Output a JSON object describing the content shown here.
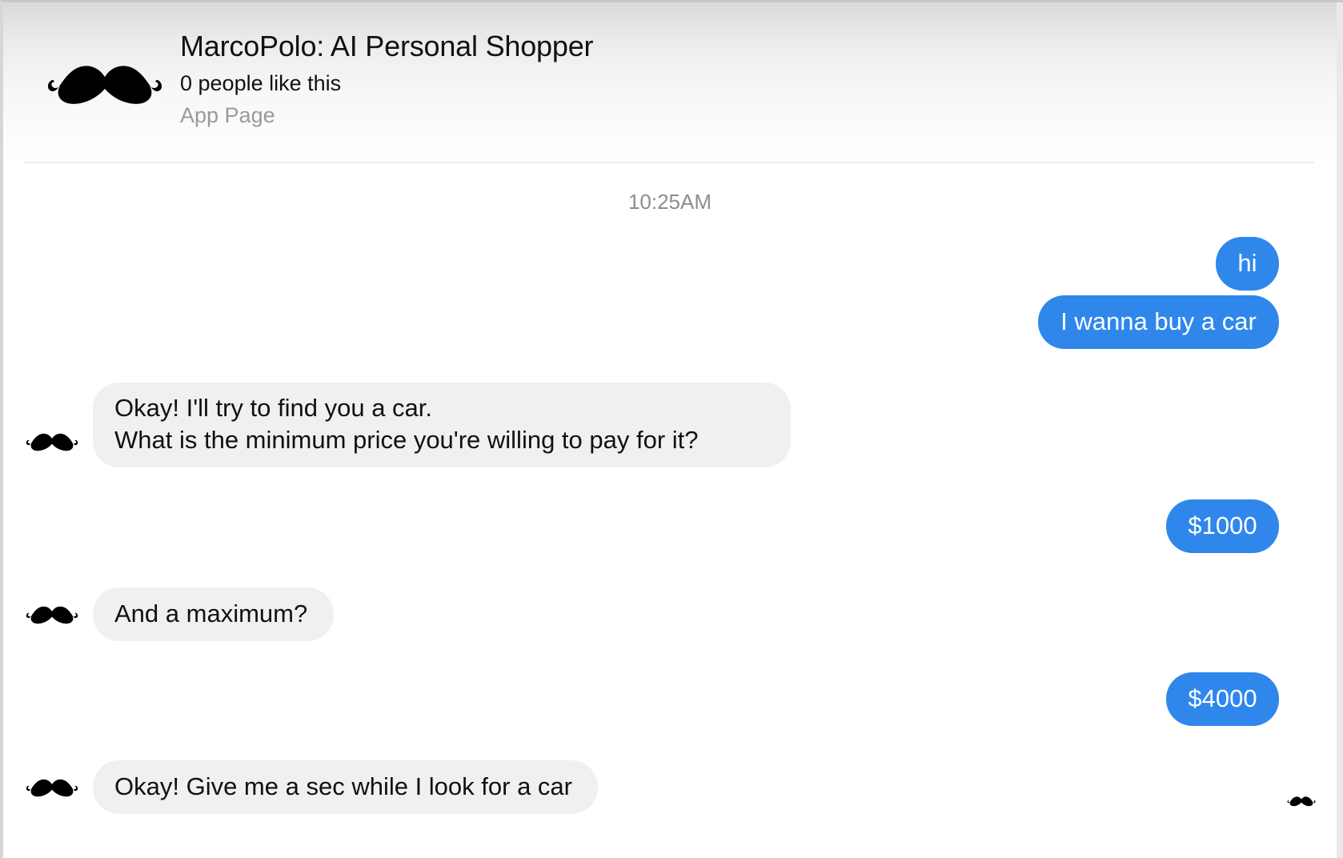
{
  "header": {
    "title": "MarcoPolo: AI Personal Shopper",
    "likes": "0 people like this",
    "page_type": "App Page",
    "avatar_icon": "mustache-icon"
  },
  "conversation": {
    "timestamp": "10:25AM",
    "messages": [
      {
        "sender": "user",
        "text": "hi"
      },
      {
        "sender": "user",
        "text": "I wanna buy a car"
      },
      {
        "sender": "bot",
        "lines": [
          "Okay! I'll try to find you a car.",
          "What is the minimum price you're willing to pay for it?"
        ]
      },
      {
        "sender": "user",
        "text": "$1000"
      },
      {
        "sender": "bot",
        "text": "And a maximum?"
      },
      {
        "sender": "user",
        "text": "$4000"
      },
      {
        "sender": "bot",
        "text": "Okay! Give me a sec while I look for a car"
      }
    ],
    "seen_indicator_icon": "mustache-icon"
  },
  "colors": {
    "outgoing_bubble": "#2f87ec",
    "incoming_bubble": "#f0f0f0",
    "timestamp_text": "#8e8e8e",
    "secondary_text": "#9a9a9a"
  }
}
